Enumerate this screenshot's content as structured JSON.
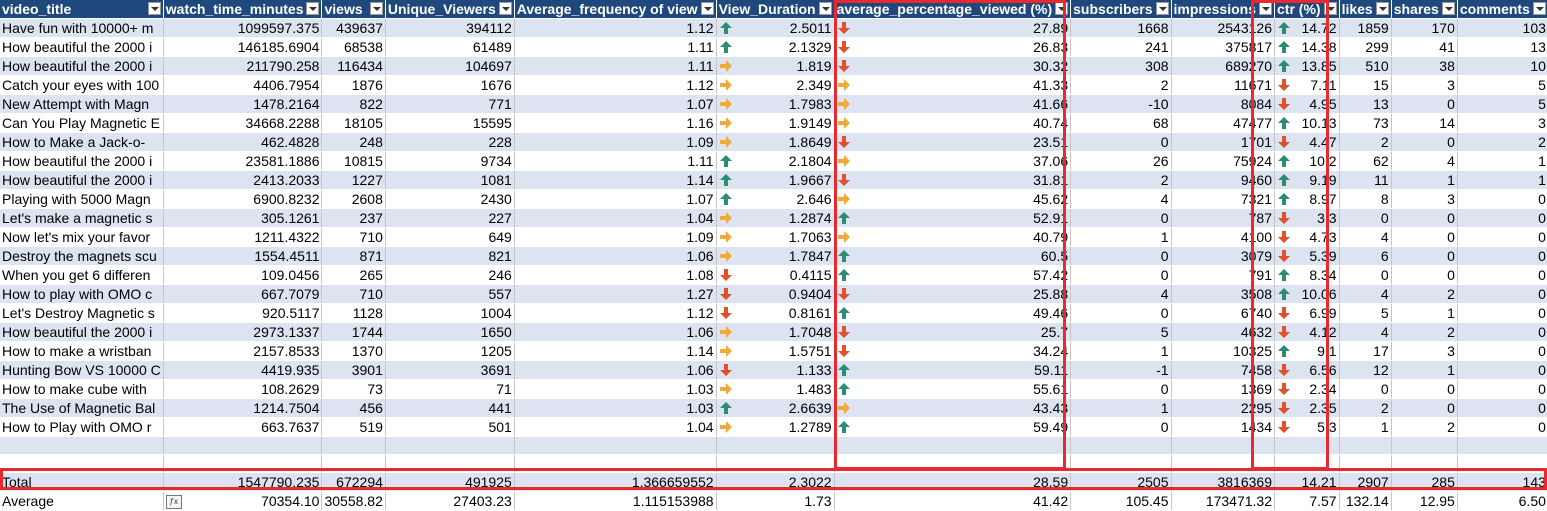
{
  "columns": [
    "video_title",
    "watch_time_minutes",
    "views",
    "Unique_Viewers",
    "Average_frequency of view",
    "View_Duration",
    "average_percentage_viewed (%)",
    "subscribers",
    "impressions",
    "ctr (%)",
    "likes",
    "shares",
    "comments"
  ],
  "rows": [
    [
      "Have fun with 10000+ m",
      "1099597.375",
      "439637",
      "394112",
      "1.12",
      "up",
      "2.5011",
      "down",
      "27.89",
      "1668",
      "2543126",
      "up",
      "14.72",
      "1859",
      "170",
      "103"
    ],
    [
      "How beautiful the 2000 i",
      "146185.6904",
      "68538",
      "61489",
      "1.11",
      "up",
      "2.1329",
      "down",
      "26.83",
      "241",
      "375817",
      "up",
      "14.38",
      "299",
      "41",
      "13"
    ],
    [
      "How beautiful the 2000 i",
      "211790.258",
      "116434",
      "104697",
      "1.11",
      "side",
      "1.819",
      "down",
      "30.32",
      "308",
      "689270",
      "up",
      "13.85",
      "510",
      "38",
      "10"
    ],
    [
      "Catch your eyes with 100",
      "4406.7954",
      "1876",
      "1676",
      "1.12",
      "side",
      "2.349",
      "side",
      "41.33",
      "2",
      "11671",
      "down",
      "7.11",
      "15",
      "3",
      "5"
    ],
    [
      "New Attempt with Magn",
      "1478.2164",
      "822",
      "771",
      "1.07",
      "side",
      "1.7983",
      "side",
      "41.66",
      "-10",
      "8084",
      "down",
      "4.95",
      "13",
      "0",
      "5"
    ],
    [
      "Can You Play Magnetic E",
      "34668.2288",
      "18105",
      "15595",
      "1.16",
      "side",
      "1.9149",
      "side",
      "40.74",
      "68",
      "47477",
      "up",
      "10.13",
      "73",
      "14",
      "3"
    ],
    [
      "How to Make a Jack-o-",
      "462.4828",
      "248",
      "228",
      "1.09",
      "side",
      "1.8649",
      "down",
      "23.51",
      "0",
      "1701",
      "down",
      "4.47",
      "2",
      "0",
      "2"
    ],
    [
      "How beautiful the 2000 i",
      "23581.1886",
      "10815",
      "9734",
      "1.11",
      "up",
      "2.1804",
      "side",
      "37.06",
      "26",
      "75924",
      "up",
      "10.2",
      "62",
      "4",
      "1"
    ],
    [
      "How beautiful the 2000 i",
      "2413.2033",
      "1227",
      "1081",
      "1.14",
      "up",
      "1.9667",
      "down",
      "31.81",
      "2",
      "9460",
      "up",
      "9.19",
      "11",
      "1",
      "1"
    ],
    [
      "Playing with 5000 Magn",
      "6900.8232",
      "2608",
      "2430",
      "1.07",
      "up",
      "2.646",
      "side",
      "45.62",
      "4",
      "7321",
      "up",
      "8.97",
      "8",
      "3",
      "0"
    ],
    [
      "Let's make a magnetic s",
      "305.1261",
      "237",
      "227",
      "1.04",
      "side",
      "1.2874",
      "up",
      "52.91",
      "0",
      "787",
      "down",
      "3.3",
      "0",
      "0",
      "0"
    ],
    [
      "Now let's mix your favor",
      "1211.4322",
      "710",
      "649",
      "1.09",
      "side",
      "1.7063",
      "side",
      "40.79",
      "1",
      "4100",
      "down",
      "4.73",
      "4",
      "0",
      "0"
    ],
    [
      "Destroy the magnets scu",
      "1554.4511",
      "871",
      "821",
      "1.06",
      "side",
      "1.7847",
      "up",
      "60.5",
      "0",
      "3079",
      "down",
      "5.39",
      "6",
      "0",
      "0"
    ],
    [
      "When you get 6 differen",
      "109.0456",
      "265",
      "246",
      "1.08",
      "down",
      "0.4115",
      "up",
      "57.42",
      "0",
      "791",
      "up",
      "8.34",
      "0",
      "0",
      "0"
    ],
    [
      "How to play with OMO c",
      "667.7079",
      "710",
      "557",
      "1.27",
      "down",
      "0.9404",
      "down",
      "25.88",
      "4",
      "3508",
      "up",
      "10.06",
      "4",
      "2",
      "0"
    ],
    [
      "Let's Destroy Magnetic s",
      "920.5117",
      "1128",
      "1004",
      "1.12",
      "down",
      "0.8161",
      "up",
      "49.46",
      "0",
      "6740",
      "down",
      "6.99",
      "5",
      "1",
      "0"
    ],
    [
      "How beautiful the 2000 i",
      "2973.1337",
      "1744",
      "1650",
      "1.06",
      "side",
      "1.7048",
      "down",
      "25.7",
      "5",
      "4632",
      "down",
      "4.12",
      "4",
      "2",
      "0"
    ],
    [
      "How to make a wristban",
      "2157.8533",
      "1370",
      "1205",
      "1.14",
      "side",
      "1.5751",
      "down",
      "34.24",
      "1",
      "10325",
      "up",
      "9.1",
      "17",
      "3",
      "0"
    ],
    [
      "Hunting Bow VS 10000 C",
      "4419.935",
      "3901",
      "3691",
      "1.06",
      "down",
      "1.133",
      "up",
      "59.11",
      "-1",
      "7458",
      "down",
      "6.56",
      "12",
      "1",
      "0"
    ],
    [
      "How to make cube with",
      "108.2629",
      "73",
      "71",
      "1.03",
      "side",
      "1.483",
      "up",
      "55.61",
      "0",
      "1369",
      "down",
      "2.34",
      "0",
      "0",
      "0"
    ],
    [
      "The Use of Magnetic Bal",
      "1214.7504",
      "456",
      "441",
      "1.03",
      "up",
      "2.6639",
      "side",
      "43.43",
      "1",
      "2295",
      "down",
      "2.35",
      "2",
      "0",
      "0"
    ],
    [
      "How to Play with OMO r",
      "663.7637",
      "519",
      "501",
      "1.04",
      "side",
      "1.2789",
      "up",
      "59.49",
      "0",
      "1434",
      "down",
      "5.3",
      "1",
      "2",
      "0"
    ]
  ],
  "total": [
    "Total",
    "1547790.235",
    "672294",
    "491925",
    "1.366659552",
    "2.3022",
    "28.59",
    "2505",
    "3816369",
    "14.21",
    "2907",
    "285",
    "143"
  ],
  "average": [
    "Average",
    "70354.10",
    "30558.82",
    "27403.23",
    "1.115153988",
    "1.73",
    "41.42",
    "105.45",
    "173471.32",
    "7.57",
    "132.14",
    "12.95",
    "6.50"
  ],
  "colors": {
    "header": "#1f497d",
    "band": "#dce3f1",
    "highlight": "#e8292e",
    "up": "#2e8b74",
    "down": "#e0502a",
    "side": "#f2a93b"
  }
}
